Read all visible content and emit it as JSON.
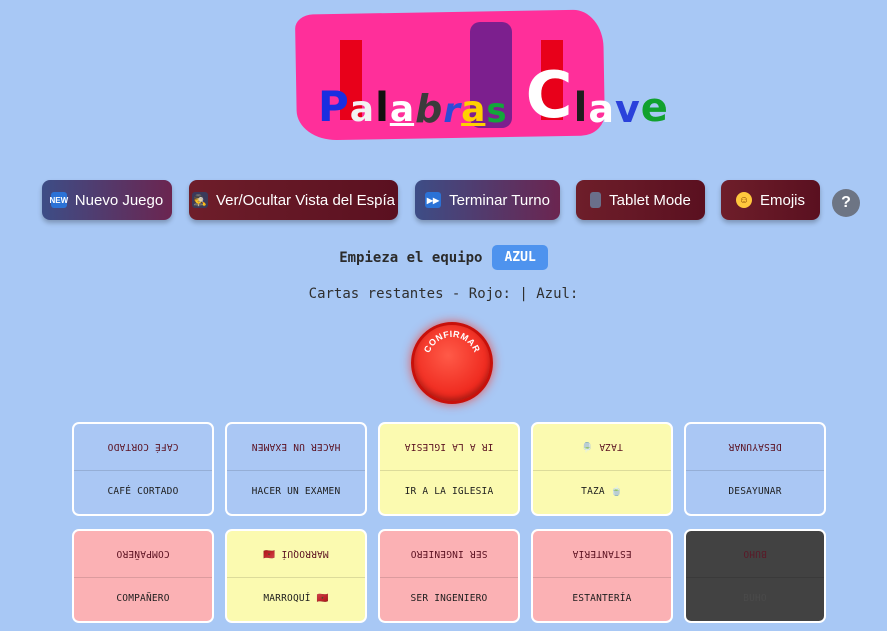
{
  "logo": {
    "letters": [
      "P",
      "a",
      "l",
      "a",
      "b",
      "r",
      "a",
      "s",
      " ",
      "C",
      "l",
      "a",
      "v",
      "e"
    ],
    "word1": "Palabras",
    "word2": "Clave"
  },
  "toolbar": {
    "new_game": {
      "icon": "new-icon",
      "label": "Nuevo Juego"
    },
    "spy_view": {
      "icon": "spy-icon",
      "label": "Ver/Ocultar Vista del Espía"
    },
    "end_turn": {
      "icon": "fast-forward-icon",
      "label": "Terminar Turno"
    },
    "tablet_mode": {
      "icon": "tablet-icon",
      "label": "Tablet Mode"
    },
    "emojis": {
      "icon": "smiley-icon",
      "label": "Emojis"
    },
    "help": "?"
  },
  "status": {
    "starter_text": "Empieza el equipo",
    "starter_team": "AZUL",
    "remaining_text": "Cartas restantes - Rojo: | Azul:"
  },
  "confirm": {
    "label": "CONFIRMAR"
  },
  "cards": [
    {
      "word": "CAFÉ CORTADO",
      "color": "blue"
    },
    {
      "word": "HACER UN EXAMEN",
      "color": "blue"
    },
    {
      "word": "IR A LA IGLESIA",
      "color": "yellow"
    },
    {
      "word": "TAZA 🍵",
      "color": "yellow"
    },
    {
      "word": "DESAYUNAR",
      "color": "blue"
    },
    {
      "word": "COMPAÑERO",
      "color": "red"
    },
    {
      "word": "MARROQUÍ 🇲🇦",
      "color": "yellow"
    },
    {
      "word": "SER INGENIERO",
      "color": "red"
    },
    {
      "word": "ESTANTERÍA",
      "color": "red"
    },
    {
      "word": "BUHO",
      "color": "black"
    }
  ],
  "colors": {
    "background": "#a8c8f5",
    "logo_bg": "#ff2f9a",
    "blue_card": "#aac7f4",
    "yellow_card": "#fbfab0",
    "red_card": "#fbb1b4",
    "black_card": "#424242",
    "team_blue": "#4e93ee",
    "confirm_red": "#ef2a1f"
  }
}
